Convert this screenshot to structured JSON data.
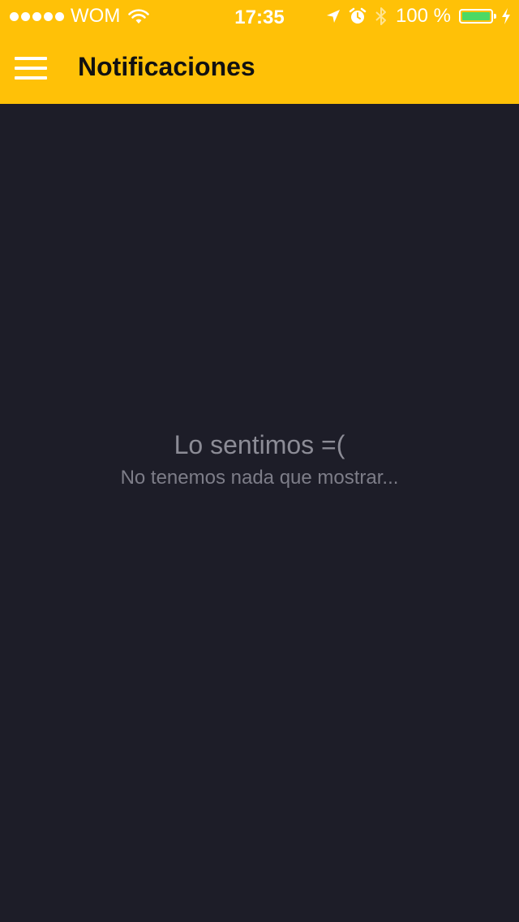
{
  "status_bar": {
    "carrier": "WOM",
    "time": "17:35",
    "battery_percent": "100 %",
    "battery_level": 1.0,
    "icons": [
      "signal-dots-icon",
      "wifi-icon",
      "location-arrow-icon",
      "alarm-icon",
      "bluetooth-icon",
      "battery-icon",
      "charging-bolt-icon"
    ]
  },
  "app_bar": {
    "title": "Notificaciones",
    "menu_icon": "hamburger-menu-icon"
  },
  "empty_state": {
    "title": "Lo sentimos =(",
    "subtitle": "No tenemos nada que mostrar..."
  },
  "colors": {
    "accent": "#ffc107",
    "background": "#1d1d28",
    "battery_fill": "#4cd964"
  }
}
